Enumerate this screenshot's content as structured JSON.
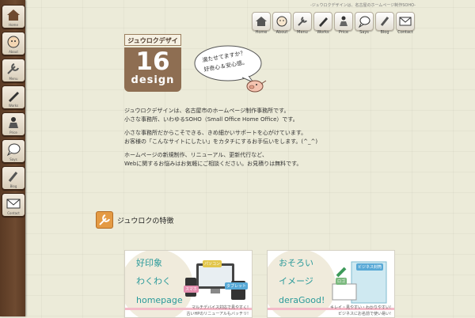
{
  "site": {
    "tagline": "-ジュウロクデザインは、名古屋のホームページ制作SOHO-"
  },
  "sidebar": {
    "items": [
      {
        "label": "Home"
      },
      {
        "label": "About"
      },
      {
        "label": "Menu"
      },
      {
        "label": "Works"
      },
      {
        "label": "Price"
      },
      {
        "label": "Says"
      },
      {
        "label": "Blog"
      },
      {
        "label": "Contact"
      }
    ]
  },
  "nav": {
    "items": [
      {
        "label": "Home"
      },
      {
        "label": "About"
      },
      {
        "label": "Menu"
      },
      {
        "label": "Works"
      },
      {
        "label": "Price"
      },
      {
        "label": "Says"
      },
      {
        "label": "Blog"
      },
      {
        "label": "Contact"
      }
    ]
  },
  "logo": {
    "top": "ジュウロクデザイン",
    "num": "16",
    "word": "design"
  },
  "bubble": {
    "line1": "満たせてますか？",
    "line2": "好奇心＆安心感。"
  },
  "intro": {
    "p1a": "ジュウロクデザインは、名古屋市のホームページ制作事務所です。",
    "p1b": "小さな事務所、いわゆるSOHO（Small Office Home Office）です。",
    "p2a": "小さな事務所だからこそできる、きめ細かいサポートを心がけています。",
    "p2b": "お客様の「こんなサイトにしたい」をカタチにするお手伝いをします。(^_^)",
    "p3a": "ホームページの新規制作、リニューアル、更新代行など、",
    "p3b": "Webに関するお悩みはお気軽にご相談ください。お見積りは無料です。"
  },
  "section": {
    "title": "ジュウロクの特徴"
  },
  "cards": [
    {
      "l1": "好印象",
      "l2": "わくわく",
      "l3": "homepage",
      "tag1": "パソコン",
      "tag2": "スマホ",
      "tag3": "タブレット",
      "foot1": "マルチデバイス対応で見やすく!",
      "foot2": "古いHPのリニューアルもバッチリ!"
    },
    {
      "l1": "おそろい",
      "l2": "イメージ",
      "l3": "deraGood!",
      "tag1": "ビジネス封筒",
      "tag2": "ロゴ",
      "foot1": "キレイ・見やすい・わかりやすい!",
      "foot2": "ビジネスにお名前で使い易い!"
    }
  ],
  "colors": {
    "sidebar": "#6e4a30",
    "accent": "#2a9a9a",
    "logo": "#8e6e52"
  }
}
